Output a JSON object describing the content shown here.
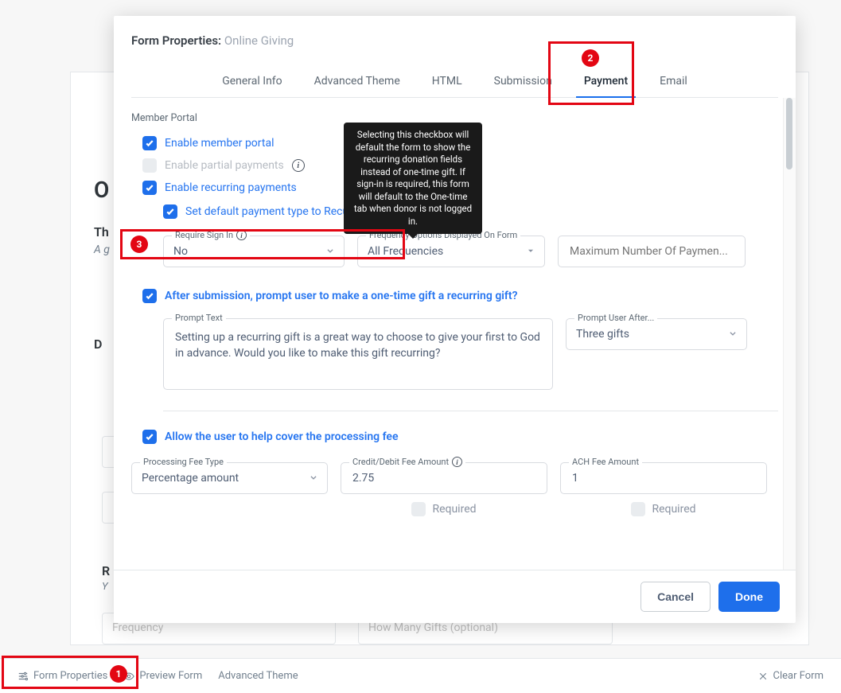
{
  "background": {
    "letters": {
      "O": "O",
      "Th": "Th",
      "Ag": "A g",
      "D": "D",
      "R": "R",
      "Y": "Y"
    },
    "freq_placeholder": "Frequency",
    "howmany_placeholder": "How Many Gifts  (optional)"
  },
  "bottombar": {
    "form_properties": "Form Properties",
    "preview_form": "Preview Form",
    "advanced_theme": "Advanced Theme",
    "clear_form": "Clear Form"
  },
  "modal": {
    "title_prefix": "Form Properties:",
    "title_suffix": "Online Giving",
    "tabs": {
      "general": "General Info",
      "advanced": "Advanced Theme",
      "html": "HTML",
      "submission": "Submission",
      "payment": "Payment",
      "email": "Email"
    },
    "section1": {
      "title": "Member Portal",
      "opt1": "Enable member portal",
      "opt2": "Enable partial payments",
      "opt3": "Enable recurring payments",
      "opt4": "Set default payment type to Recurring"
    },
    "tooltip": "Selecting this checkbox will default the form to show the recurring donation fields instead of one-time gift. If sign-in is required, this form will default to the One-time tab when donor is not logged in.",
    "signin": {
      "label": "Require Sign In",
      "value": "No"
    },
    "freq_opts": {
      "label": "Frequency Options Displayed On Form",
      "value": "All Frequencies"
    },
    "max_pay": {
      "placeholder": "Maximum Number Of Paymen..."
    },
    "after_submit": "After submission, prompt user to make a one-time gift a recurring gift?",
    "prompt_text_label": "Prompt Text",
    "prompt_text_value": "Setting up a recurring gift is a great way to choose to give your first to God in advance. Would you like to make this gift recurring?",
    "prompt_after_label": "Prompt User After...",
    "prompt_after_value": "Three gifts",
    "cover_fee": "Allow the user to help cover the processing fee",
    "fee_type_label": "Processing Fee Type",
    "fee_type_value": "Percentage amount",
    "credit_label": "Credit/Debit Fee Amount",
    "credit_value": "2.75",
    "ach_label": "ACH Fee Amount",
    "ach_value": "1",
    "required": "Required",
    "cancel": "Cancel",
    "done": "Done"
  },
  "annotations": {
    "one": "1",
    "two": "2",
    "three": "3"
  }
}
